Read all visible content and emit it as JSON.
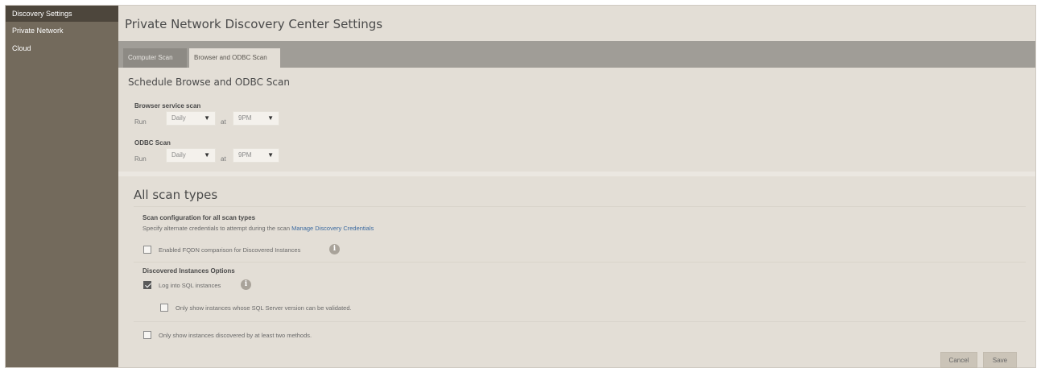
{
  "sidebar": {
    "items": [
      {
        "label": "Discovery Settings"
      },
      {
        "label": "Private Network"
      },
      {
        "label": "Cloud"
      }
    ]
  },
  "header": {
    "title": "Private Network Discovery Center Settings"
  },
  "tabs": [
    {
      "label": "Computer Scan"
    },
    {
      "label": "Browser and ODBC Scan"
    }
  ],
  "schedule": {
    "title": "Schedule Browse and ODBC Scan",
    "browser": {
      "label": "Browser service scan",
      "run_label": "Run",
      "frequency": "Daily",
      "at_label": "at",
      "time": "9PM"
    },
    "odbc": {
      "label": "ODBC Scan",
      "run_label": "Run",
      "frequency": "Daily",
      "at_label": "at",
      "time": "9PM"
    }
  },
  "all_scan": {
    "title": "All scan types",
    "config_heading": "Scan configuration for all scan types",
    "config_desc": "Specify alternate credentials to attempt during the scan",
    "config_link": "Manage Discovery Credentials",
    "fqdn_label": "Enabled FQDN comparison for Discovered Instances",
    "instances_heading": "Discovered Instances Options",
    "log_into_label": "Log into SQL instances",
    "only_validated_label": "Only show instances whose SQL Server version can be validated.",
    "two_methods_label": "Only show instances discovered by at least two methods."
  },
  "buttons": {
    "cancel": "Cancel",
    "save": "Save"
  },
  "icons": {
    "info": "i",
    "dropdown": "▼"
  },
  "colors": {
    "sidebar": "#736a5c",
    "sidebar_active": "#4d463c",
    "tabbar": "#a09d97",
    "link": "#3b6aa0"
  }
}
